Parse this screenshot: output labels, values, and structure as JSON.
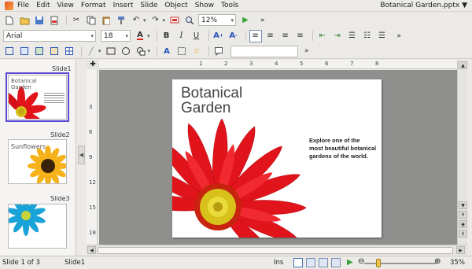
{
  "menubar": {
    "items": [
      "File",
      "Edit",
      "View",
      "Format",
      "Insert",
      "Slide",
      "Object",
      "Show",
      "Tools"
    ],
    "document_title": "Botanical Garden.pptx ▼"
  },
  "toolbar": {
    "zoom_value": "12%",
    "overflow": "»",
    "font_name": "Arial",
    "font_size": "18",
    "search_value": ""
  },
  "colors": {
    "accent": "#5b4ad6",
    "canvas": "#8f8f8e",
    "flower_red": "#e2141b",
    "flower_center": "#d7c11a"
  },
  "sidebar": {
    "slides": [
      {
        "label": "Slide1",
        "title": "Botanical\nGarden",
        "selected": true
      },
      {
        "label": "Slide2",
        "title": "Sunflowers",
        "selected": false
      },
      {
        "label": "Slide3",
        "title": "",
        "selected": false
      }
    ]
  },
  "ruler": {
    "h_ticks": [
      "1",
      "2",
      "3",
      "4",
      "5",
      "6",
      "7",
      "8"
    ],
    "v_ticks": [
      "3",
      "6",
      "9",
      "12",
      "15",
      "18"
    ]
  },
  "slide": {
    "title": "Botanical\nGarden",
    "body": "Explore one of the\nmost beautiful botanical\ngardens of the world."
  },
  "statusbar": {
    "slide_info": "Slide 1 of 3",
    "layout_name": "Slide1",
    "insert_mode": "Ins",
    "zoom_percent": "35%"
  }
}
